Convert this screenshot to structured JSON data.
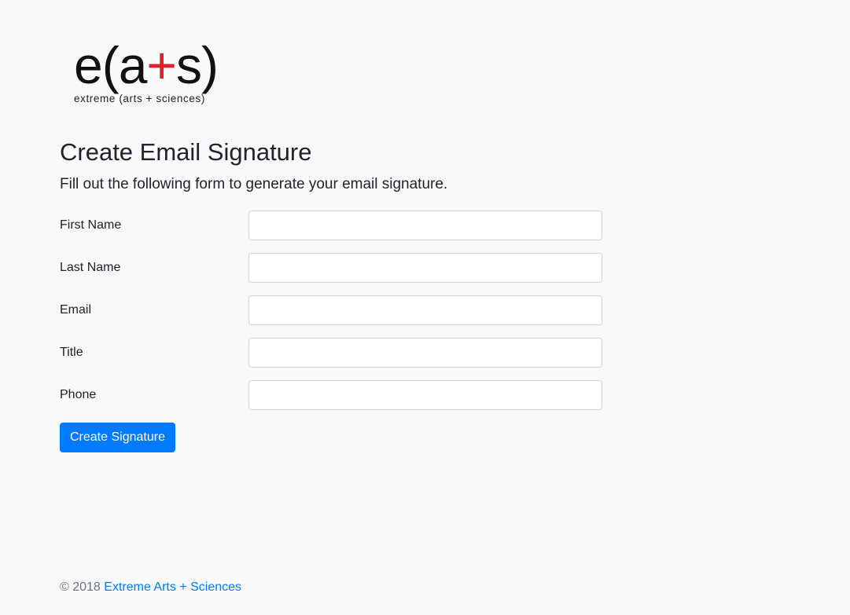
{
  "logo": {
    "mark_e": "e(",
    "mark_a": "a",
    "mark_plus": "+",
    "mark_s": "s)",
    "tagline": "extreme (arts + sciences)",
    "accent_color": "#e0202a"
  },
  "page": {
    "title": "Create Email Signature",
    "lead": "Fill out the following form to generate your email signature."
  },
  "form": {
    "fields": [
      {
        "label": "First Name",
        "value": "",
        "placeholder": ""
      },
      {
        "label": "Last Name",
        "value": "",
        "placeholder": ""
      },
      {
        "label": "Email",
        "value": "",
        "placeholder": ""
      },
      {
        "label": "Title",
        "value": "",
        "placeholder": ""
      },
      {
        "label": "Phone",
        "value": "",
        "placeholder": ""
      }
    ],
    "submit_label": "Create Signature",
    "button_color": "#007bff"
  },
  "footer": {
    "copyright": "© 2018",
    "link_text": "Extreme Arts + Sciences"
  }
}
